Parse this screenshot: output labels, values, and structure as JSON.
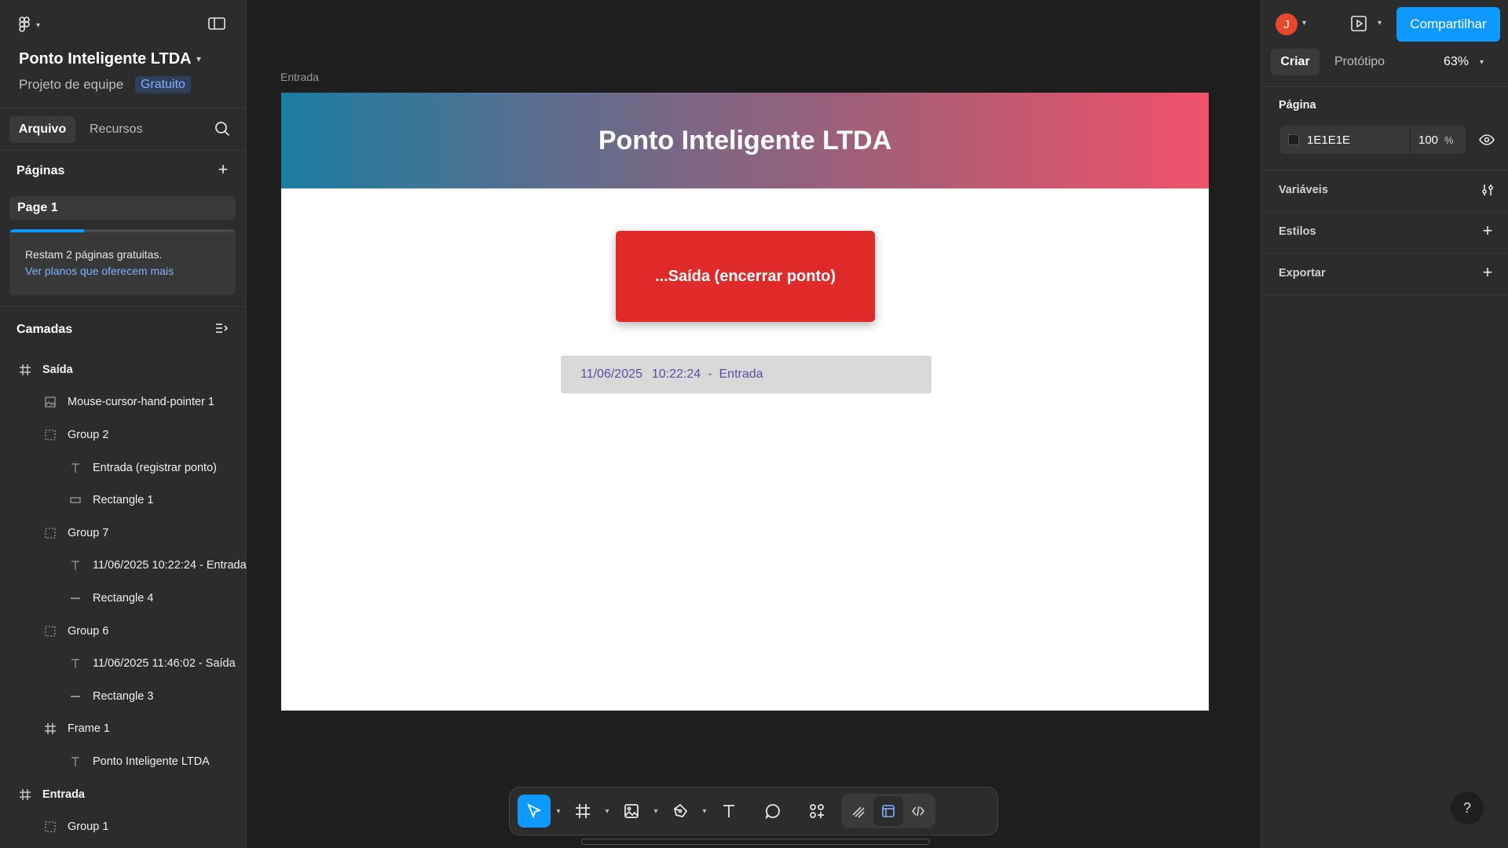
{
  "project": {
    "title": "Ponto Inteligente LTDA",
    "subtitle": "Projeto de equipe",
    "plan_badge": "Gratuito"
  },
  "left_tabs": {
    "file": "Arquivo",
    "assets": "Recursos"
  },
  "pages": {
    "title": "Páginas",
    "items": [
      "Page 1"
    ],
    "promo_text": "Restam 2 páginas gratuitas.",
    "promo_link": "Ver planos que oferecem mais",
    "promo_progress": 0.33
  },
  "layers": {
    "title": "Camadas",
    "items": [
      {
        "name": "Saída",
        "icon": "frame-icon",
        "level": 0
      },
      {
        "name": "Mouse-cursor-hand-pointer 1",
        "icon": "image-icon",
        "level": 1
      },
      {
        "name": "Group 2",
        "icon": "group-icon",
        "level": 1
      },
      {
        "name": "Entrada (registrar ponto)",
        "icon": "text-icon",
        "level": 2
      },
      {
        "name": "Rectangle 1",
        "icon": "rectangle-icon",
        "level": 2
      },
      {
        "name": "Group 7",
        "icon": "group-icon",
        "level": 1
      },
      {
        "name": "11/06/2025 10:22:24 - Entrada",
        "icon": "text-icon",
        "level": 2
      },
      {
        "name": "Rectangle 4",
        "icon": "line-icon",
        "level": 2
      },
      {
        "name": "Group 6",
        "icon": "group-icon",
        "level": 1
      },
      {
        "name": "11/06/2025 11:46:02 - Saída",
        "icon": "text-icon",
        "level": 2
      },
      {
        "name": "Rectangle 3",
        "icon": "line-icon",
        "level": 2
      },
      {
        "name": "Frame 1",
        "icon": "frame-icon",
        "level": 1
      },
      {
        "name": "Ponto Inteligente LTDA",
        "icon": "text-icon",
        "level": 2
      },
      {
        "name": "Entrada",
        "icon": "frame-icon",
        "level": 0
      },
      {
        "name": "Group 1",
        "icon": "group-icon",
        "level": 1
      }
    ]
  },
  "canvas": {
    "frame_label": "Entrada",
    "banner_title": "Ponto Inteligente LTDA",
    "button_label": "...Saída (encerrar ponto)",
    "record": {
      "date": "11/06/2025",
      "time": "10:22:24",
      "sep": "-",
      "type": "Entrada"
    }
  },
  "right_panel": {
    "avatar_initial": "J",
    "share_label": "Compartilhar",
    "tabs": {
      "design": "Criar",
      "prototype": "Protótipo"
    },
    "zoom": "63%",
    "page_section": "Página",
    "page_color": "1E1E1E",
    "page_opacity": "100",
    "opacity_unit": "%",
    "variables": "Variáveis",
    "styles": "Estilos",
    "export": "Exportar"
  },
  "colors": {
    "accent": "#0d99ff",
    "button_red": "#e02a2a",
    "avatar": "#e8482c",
    "banner_start": "#1a7da1",
    "banner_end": "#f0526a"
  },
  "help_label": "?"
}
